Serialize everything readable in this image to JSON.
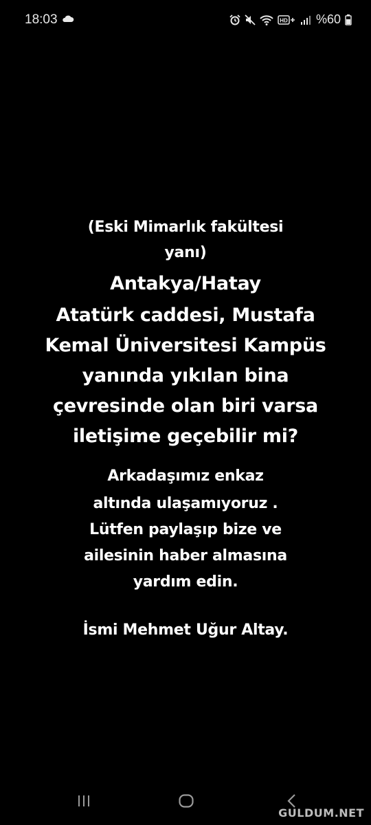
{
  "status_bar": {
    "time": "18:03",
    "battery": "%60",
    "icons": [
      "cloud-icon",
      "alarm-icon",
      "mute-icon",
      "wifi-icon",
      "hd-icon",
      "signal-icon",
      "battery-icon"
    ]
  },
  "story": {
    "lines": [
      "(Eski Mimarlık fakültesi",
      "yanı)",
      "Antakya/Hatay",
      "Atatürk caddesi, Mustafa",
      "Kemal Üniversitesi Kampüs",
      "yanında yıkılan bina",
      "çevresinde olan biri varsa",
      "iletişime geçebilir mi?",
      "Arkadaşımız enkaz",
      "altında ulaşamıyoruz .",
      "Lütfen paylaşıp bize ve",
      "ailesinin haber almasına",
      "yardım edin.",
      "İsmi Mehmet Uğur Altay."
    ]
  },
  "nav": {
    "buttons": [
      "recent-apps",
      "home",
      "back"
    ]
  },
  "watermark": "GULDUM.NET"
}
